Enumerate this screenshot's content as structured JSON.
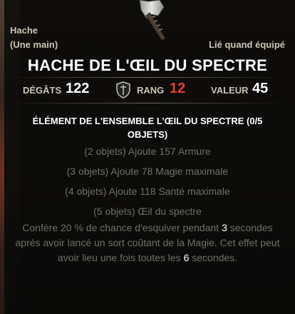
{
  "item": {
    "type": "Hache",
    "hand": "(Une main)",
    "bound": "Lié quand équipé",
    "name": "HACHE DE L'ŒIL DU SPECTRE",
    "icon": "axe-icon"
  },
  "stats": {
    "damage_label": "DÉGÂTS",
    "damage_value": "122",
    "rank_label": "RANG",
    "rank_value": "12",
    "value_label": "VALEUR",
    "value_value": "45",
    "rank_icon": "shield-icon",
    "rank_color": "#e23b3b"
  },
  "set": {
    "title": "ÉLÉMENT DE L'ENSEMBLE L’ŒIL DU SPECTRE (0/5 OBJETS)",
    "bonuses": [
      "(2 objets) Ajoute 157 Armure",
      "(3 objets) Ajoute 78 Magie maximale",
      "(4 objets) Ajoute 118 Santé maximale",
      "(5 objets) Œil du spectre"
    ],
    "desc_1": "Confère 20 % de chance d'esquiver pendant ",
    "desc_n1": "3",
    "desc_2": " secondes après avoir lancé un sort coûtant de la Magie. Cet effet peut avoir lieu une fois toutes les ",
    "desc_n2": "6",
    "desc_3": " secondes."
  }
}
